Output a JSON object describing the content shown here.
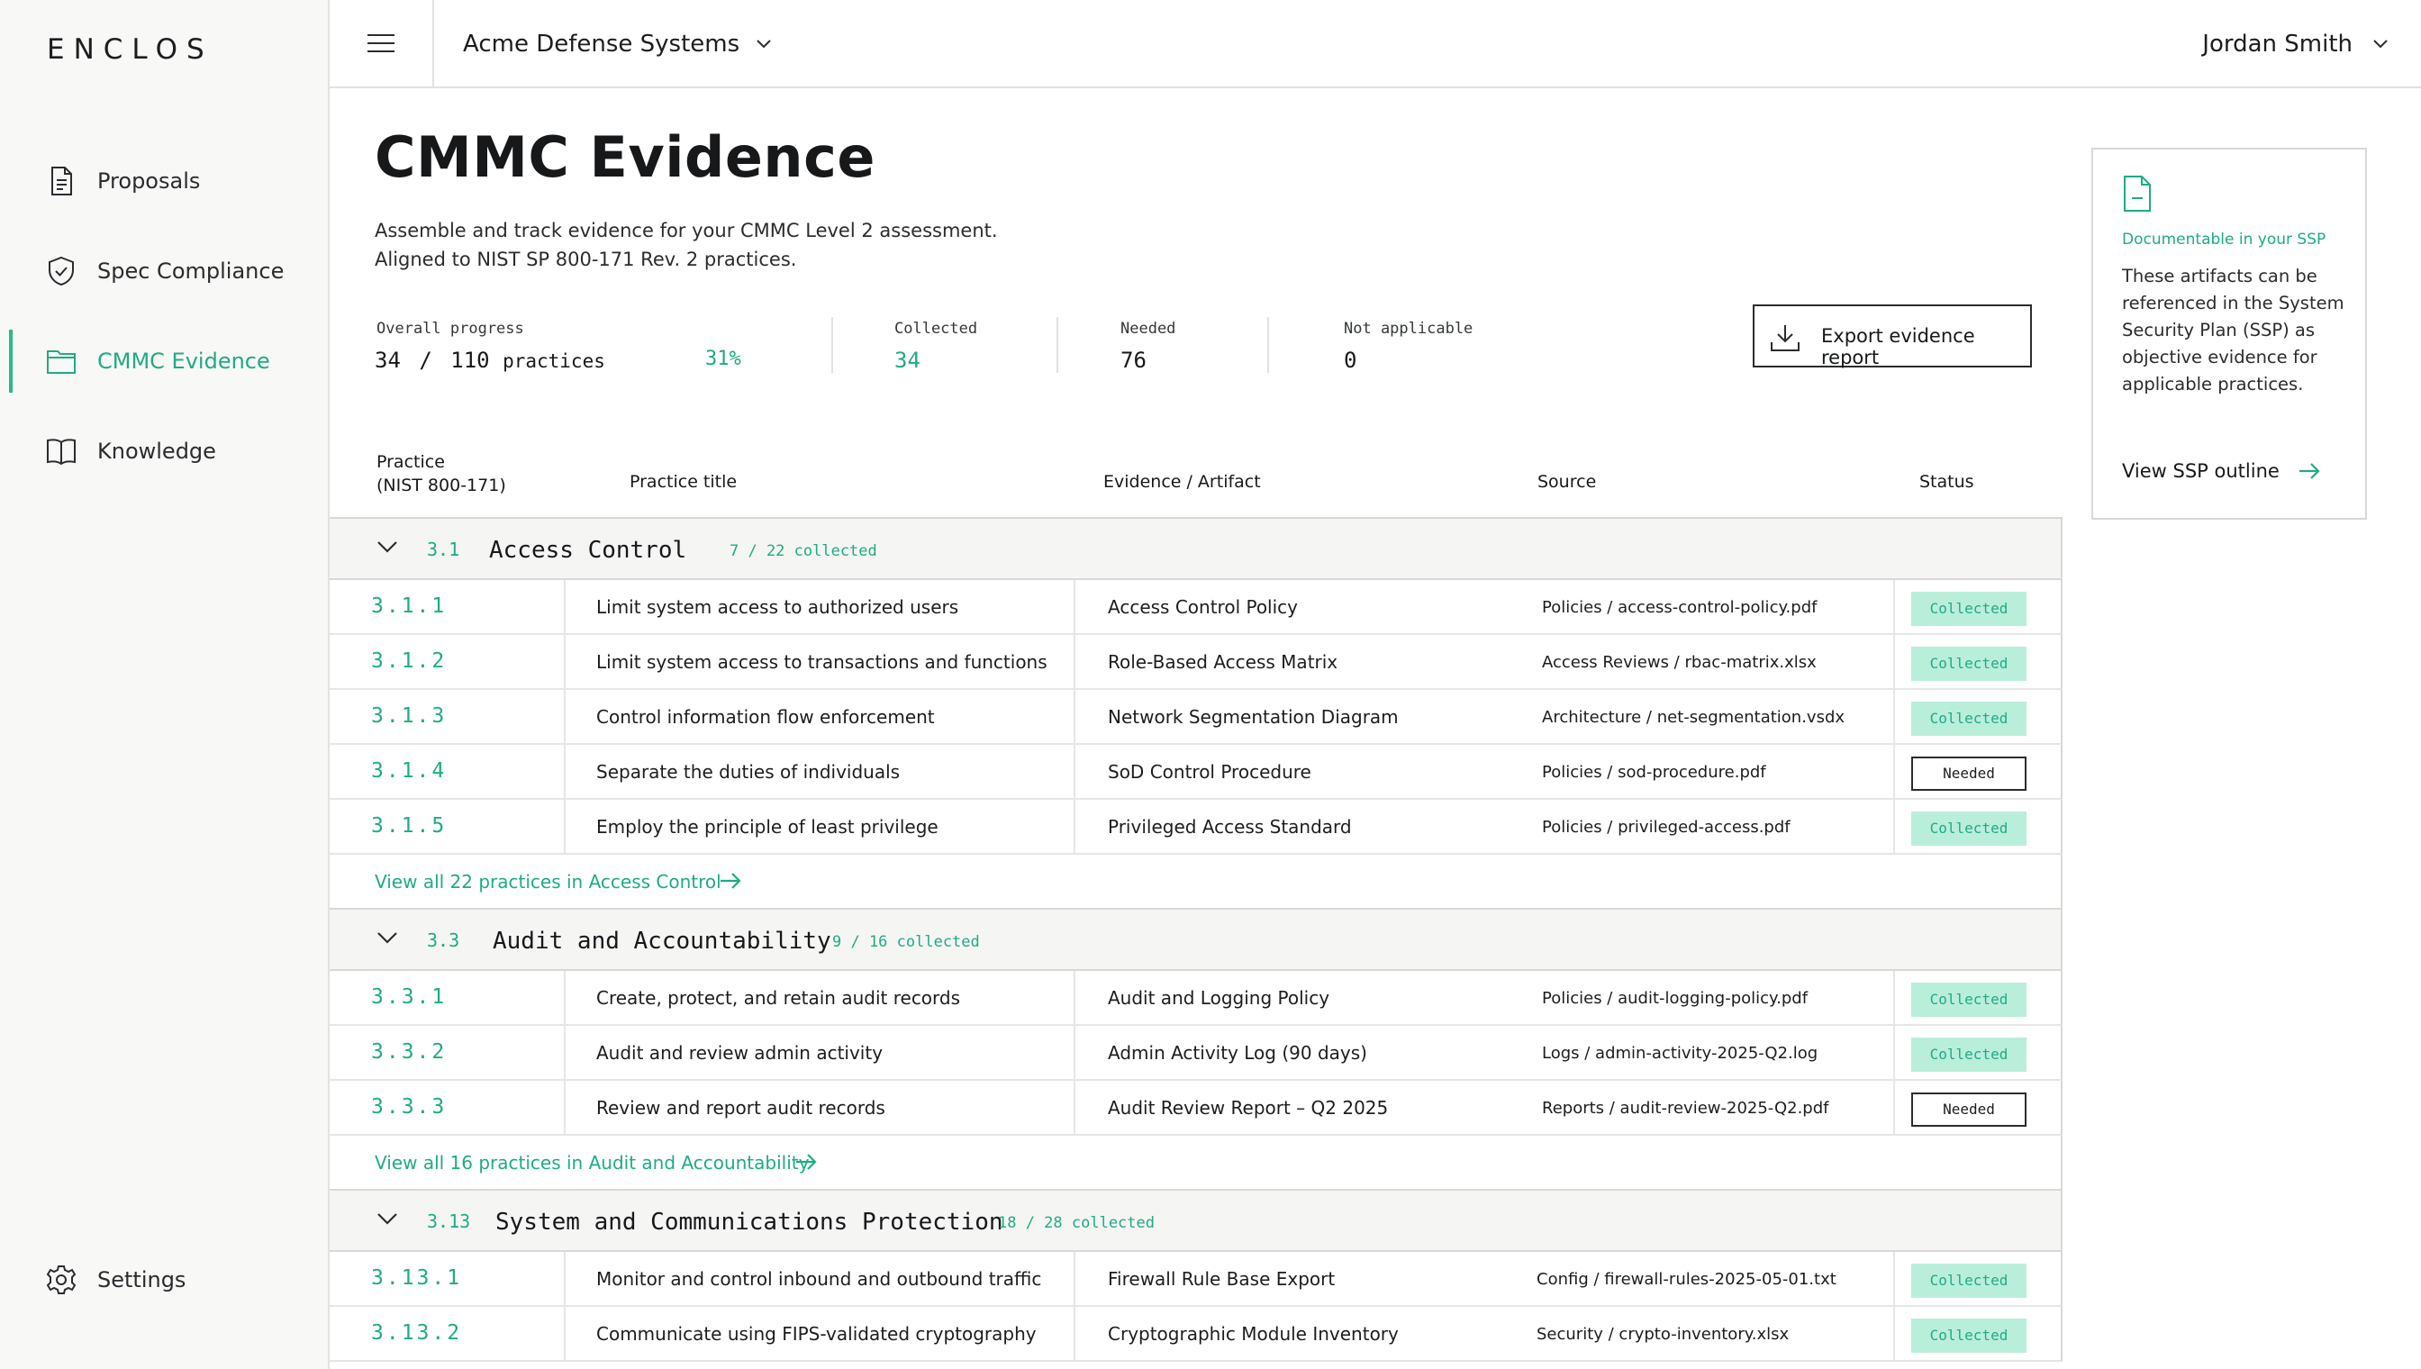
{
  "brand": "ENCLOS",
  "sidebar": {
    "items": [
      {
        "label": "Proposals",
        "icon": "document-icon"
      },
      {
        "label": "Spec Compliance",
        "icon": "shield-check-icon"
      },
      {
        "label": "CMMC Evidence",
        "icon": "folder-icon",
        "active": true
      },
      {
        "label": "Knowledge",
        "icon": "book-icon"
      }
    ],
    "settings": {
      "label": "Settings",
      "icon": "gear-icon"
    }
  },
  "topbar": {
    "org": "Acme Defense Systems",
    "user": "Jordan Smith"
  },
  "page": {
    "title": "CMMC Evidence",
    "subtitle_line1": "Assemble and track evidence for your CMMC Level 2 assessment.",
    "subtitle_line2": "Aligned to NIST SP 800-171 Rev. 2 practices."
  },
  "stats": {
    "overall_label": "Overall progress",
    "overall_done": "34",
    "overall_sep": "/",
    "overall_total": "110",
    "overall_unit": "practices",
    "overall_pct": "31%",
    "overall_fraction": 0.31,
    "collected_label": "Collected",
    "collected_value": "34",
    "needed_label": "Needed",
    "needed_value": "76",
    "na_label": "Not applicable",
    "na_value": "0"
  },
  "export_label": "Export evidence report",
  "table": {
    "headers": {
      "practice_line1": "Practice",
      "practice_line2": "(NIST 800-171)",
      "title": "Practice title",
      "evidence": "Evidence / Artifact",
      "source": "Source",
      "status": "Status"
    },
    "groups": [
      {
        "id": "3.1",
        "name": "Access Control",
        "count": "7 / 22 collected",
        "rows": [
          {
            "id": "3.1.1",
            "title": "Limit system access to authorized users",
            "evidence": "Access Control Policy",
            "source": "Policies / access-control-policy.pdf",
            "status": "Collected"
          },
          {
            "id": "3.1.2",
            "title": "Limit system access to transactions and functions",
            "evidence": "Role-Based Access Matrix",
            "source": "Access Reviews / rbac-matrix.xlsx",
            "status": "Collected"
          },
          {
            "id": "3.1.3",
            "title": "Control information flow enforcement",
            "evidence": "Network Segmentation Diagram",
            "source": "Architecture / net-segmentation.vsdx",
            "status": "Collected"
          },
          {
            "id": "3.1.4",
            "title": "Separate the duties of individuals",
            "evidence": "SoD Control Procedure",
            "source": "Policies / sod-procedure.pdf",
            "status": "Needed"
          },
          {
            "id": "3.1.5",
            "title": "Employ the principle of least privilege",
            "evidence": "Privileged Access Standard",
            "source": "Policies / privileged-access.pdf",
            "status": "Collected"
          }
        ],
        "view_all": "View all 22 practices in Access Control"
      },
      {
        "id": "3.3",
        "name": "Audit and Accountability",
        "count": "9 / 16 collected",
        "rows": [
          {
            "id": "3.3.1",
            "title": "Create, protect, and retain audit records",
            "evidence": "Audit and Logging Policy",
            "source": "Policies / audit-logging-policy.pdf",
            "status": "Collected"
          },
          {
            "id": "3.3.2",
            "title": "Audit and review admin activity",
            "evidence": "Admin Activity Log (90 days)",
            "source": "Logs / admin-activity-2025-Q2.log",
            "status": "Collected"
          },
          {
            "id": "3.3.3",
            "title": "Review and report audit records",
            "evidence": "Audit Review Report – Q2 2025",
            "source": "Reports / audit-review-2025-Q2.pdf",
            "status": "Needed"
          }
        ],
        "view_all": "View all 16 practices in Audit and Accountability"
      },
      {
        "id": "3.13",
        "name": "System and Communications Protection",
        "count": "18 / 28 collected",
        "rows": [
          {
            "id": "3.13.1",
            "title": "Monitor and control inbound and outbound traffic",
            "evidence": "Firewall Rule Base Export",
            "source": "Config / firewall-rules-2025-05-01.txt",
            "status": "Collected"
          },
          {
            "id": "3.13.2",
            "title": "Communicate using FIPS-validated cryptography",
            "evidence": "Cryptographic Module Inventory",
            "source": "Security / crypto-inventory.xlsx",
            "status": "Collected"
          }
        ]
      }
    ]
  },
  "ssp_card": {
    "heading": "Documentable in your SSP",
    "body": "These artifacts can be referenced in the System Security Plan (SSP) as objective evidence for applicable practices.",
    "link": "View SSP outline"
  },
  "colors": {
    "accent": "#1fab85",
    "collected_bg": "#b9eedb",
    "sidebar_bg": "#f8f8f7"
  }
}
